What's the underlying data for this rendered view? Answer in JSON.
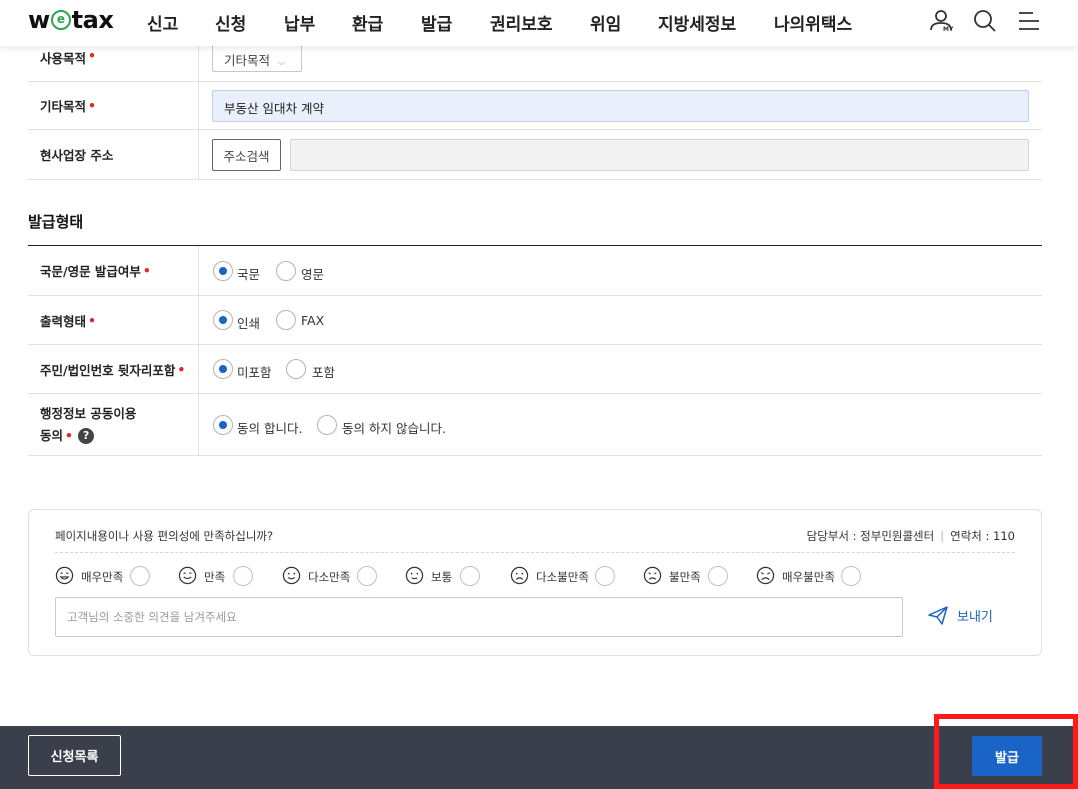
{
  "header": {
    "logo_pre": "w",
    "logo_mid": "e",
    "logo_post": "tax",
    "menu": [
      "신고",
      "신청",
      "납부",
      "환급",
      "발급",
      "권리보호",
      "위임",
      "지방세정보",
      "나의위택스"
    ],
    "my_label": "MY",
    "icons": [
      "my-user-icon",
      "search-icon",
      "menu-icon"
    ]
  },
  "form_top": {
    "purpose_label": "사용목적",
    "purpose_value": "기타목적",
    "other_label": "기타목적",
    "other_value": "부동산 임대차 계약",
    "address_label": "현사업장 주소",
    "address_button": "주소검색",
    "address_value": ""
  },
  "required_mark": "•",
  "issue_section": {
    "title": "발급형태",
    "rows": [
      {
        "label": "국문/영문 발급여부",
        "options": [
          "국문",
          "영문"
        ],
        "selected": 0
      },
      {
        "label": "출력형태",
        "options": [
          "인쇄",
          "FAX"
        ],
        "selected": 0
      },
      {
        "label": "주민/법인번호 뒷자리포함",
        "options": [
          "미포함",
          "포함"
        ],
        "selected": 0
      },
      {
        "label_line1": "행정정보 공동이용",
        "label_line2": "동의",
        "help": "?",
        "options": [
          "동의 합니다.",
          "동의 하지 않습니다."
        ],
        "selected": 0
      }
    ]
  },
  "survey": {
    "question": "페이지내용이나 사용 편의성에 만족하십니까?",
    "dept": "담당부서 : 정부민원콜센터",
    "contact": "연락처 : 110",
    "ratings": [
      "매우만족",
      "만족",
      "다소만족",
      "보통",
      "다소불만족",
      "불만족",
      "매우불만족"
    ],
    "placeholder": "고객님의 소중한 의견을 남겨주세요",
    "send": "보내기"
  },
  "footer": {
    "list_button": "신청목록",
    "issue_button": "발급"
  },
  "colors": {
    "accent": "#1a64c8",
    "required": "#e2262c",
    "footer_bg": "#3a3f4b",
    "highlight": "#ff1a1a",
    "logo_green": "#2fa44f"
  }
}
